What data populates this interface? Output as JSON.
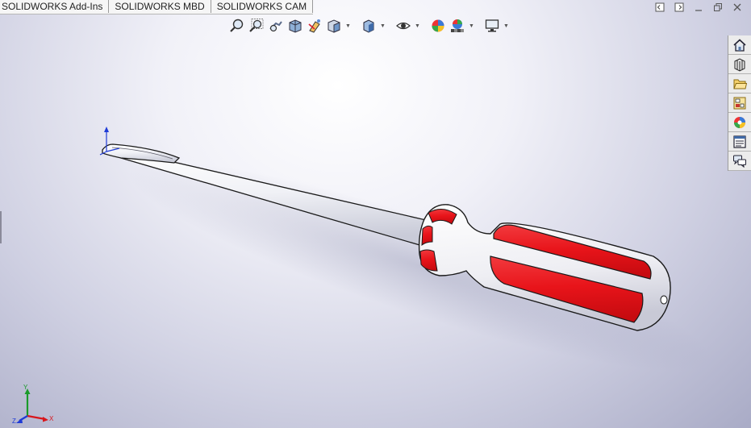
{
  "tabs": [
    {
      "label": "SOLIDWORKS Add-Ins"
    },
    {
      "label": "SOLIDWORKS MBD"
    },
    {
      "label": "SOLIDWORKS CAM"
    }
  ],
  "heads_up_toolbar": [
    {
      "icon": "zoom-to-fit-icon"
    },
    {
      "icon": "zoom-to-area-icon"
    },
    {
      "icon": "previous-view-icon"
    },
    {
      "icon": "section-view-icon"
    },
    {
      "icon": "dynamic-annotation-views-icon"
    },
    {
      "icon": "view-orientation-icon"
    },
    {
      "icon": "display-style-icon"
    },
    {
      "icon": "hide-show-items-icon"
    },
    {
      "icon": "edit-appearance-icon"
    },
    {
      "icon": "apply-scene-icon"
    },
    {
      "icon": "view-settings-icon"
    }
  ],
  "task_pane": [
    {
      "icon": "home-icon"
    },
    {
      "icon": "design-library-icon"
    },
    {
      "icon": "file-explorer-icon"
    },
    {
      "icon": "view-palette-icon"
    },
    {
      "icon": "appearances-scenes-icon"
    },
    {
      "icon": "custom-properties-icon"
    },
    {
      "icon": "forum-icon"
    }
  ],
  "window_controls": [
    {
      "icon": "tile-left-icon"
    },
    {
      "icon": "tile-right-icon"
    },
    {
      "icon": "minimize-icon"
    },
    {
      "icon": "restore-icon"
    },
    {
      "icon": "close-icon"
    }
  ],
  "triad": {
    "x_label": "X",
    "y_label": "Y",
    "z_label": "Z"
  },
  "colors": {
    "handle_red": "#e8141a",
    "shaft_white": "#f4f5f8",
    "outline": "#1a1a1a",
    "bg_light": "#ffffff",
    "bg_dark": "#a9abc6"
  }
}
